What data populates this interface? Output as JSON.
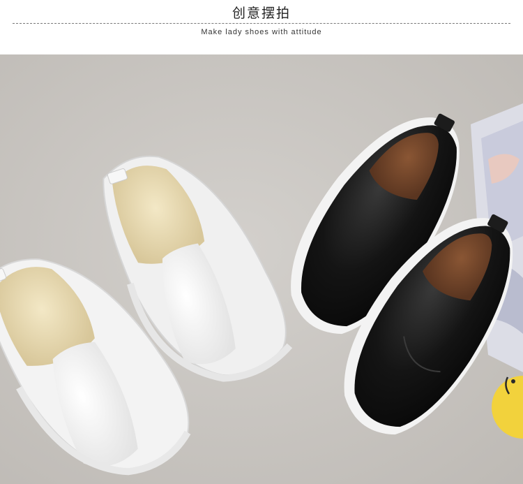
{
  "header": {
    "title": "创意摆拍",
    "subtitle": "Make lady shoes with attitude"
  },
  "photo": {
    "description_icon": "product-photo",
    "colors": {
      "background": "#c9c6c2",
      "white_shoe": "#f4f4f4",
      "white_lining": "#e9dcb5",
      "black_shoe": "#1a1a1a",
      "black_lining": "#7a4a2c",
      "sole": "#f2f2f2",
      "accent_yellow": "#f2d23c"
    }
  }
}
